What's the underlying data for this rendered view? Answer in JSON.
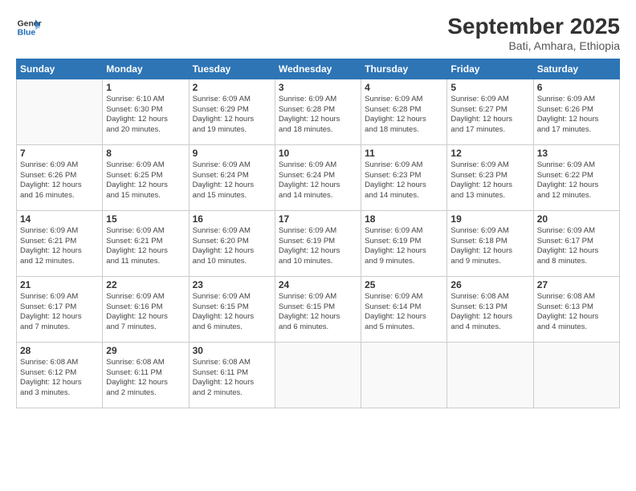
{
  "logo": {
    "line1": "General",
    "line2": "Blue"
  },
  "title": "September 2025",
  "location": "Bati, Amhara, Ethiopia",
  "days_header": [
    "Sunday",
    "Monday",
    "Tuesday",
    "Wednesday",
    "Thursday",
    "Friday",
    "Saturday"
  ],
  "weeks": [
    [
      {
        "day": "",
        "detail": ""
      },
      {
        "day": "1",
        "detail": "Sunrise: 6:10 AM\nSunset: 6:30 PM\nDaylight: 12 hours\nand 20 minutes."
      },
      {
        "day": "2",
        "detail": "Sunrise: 6:09 AM\nSunset: 6:29 PM\nDaylight: 12 hours\nand 19 minutes."
      },
      {
        "day": "3",
        "detail": "Sunrise: 6:09 AM\nSunset: 6:28 PM\nDaylight: 12 hours\nand 18 minutes."
      },
      {
        "day": "4",
        "detail": "Sunrise: 6:09 AM\nSunset: 6:28 PM\nDaylight: 12 hours\nand 18 minutes."
      },
      {
        "day": "5",
        "detail": "Sunrise: 6:09 AM\nSunset: 6:27 PM\nDaylight: 12 hours\nand 17 minutes."
      },
      {
        "day": "6",
        "detail": "Sunrise: 6:09 AM\nSunset: 6:26 PM\nDaylight: 12 hours\nand 17 minutes."
      }
    ],
    [
      {
        "day": "7",
        "detail": "Sunrise: 6:09 AM\nSunset: 6:26 PM\nDaylight: 12 hours\nand 16 minutes."
      },
      {
        "day": "8",
        "detail": "Sunrise: 6:09 AM\nSunset: 6:25 PM\nDaylight: 12 hours\nand 15 minutes."
      },
      {
        "day": "9",
        "detail": "Sunrise: 6:09 AM\nSunset: 6:24 PM\nDaylight: 12 hours\nand 15 minutes."
      },
      {
        "day": "10",
        "detail": "Sunrise: 6:09 AM\nSunset: 6:24 PM\nDaylight: 12 hours\nand 14 minutes."
      },
      {
        "day": "11",
        "detail": "Sunrise: 6:09 AM\nSunset: 6:23 PM\nDaylight: 12 hours\nand 14 minutes."
      },
      {
        "day": "12",
        "detail": "Sunrise: 6:09 AM\nSunset: 6:23 PM\nDaylight: 12 hours\nand 13 minutes."
      },
      {
        "day": "13",
        "detail": "Sunrise: 6:09 AM\nSunset: 6:22 PM\nDaylight: 12 hours\nand 12 minutes."
      }
    ],
    [
      {
        "day": "14",
        "detail": "Sunrise: 6:09 AM\nSunset: 6:21 PM\nDaylight: 12 hours\nand 12 minutes."
      },
      {
        "day": "15",
        "detail": "Sunrise: 6:09 AM\nSunset: 6:21 PM\nDaylight: 12 hours\nand 11 minutes."
      },
      {
        "day": "16",
        "detail": "Sunrise: 6:09 AM\nSunset: 6:20 PM\nDaylight: 12 hours\nand 10 minutes."
      },
      {
        "day": "17",
        "detail": "Sunrise: 6:09 AM\nSunset: 6:19 PM\nDaylight: 12 hours\nand 10 minutes."
      },
      {
        "day": "18",
        "detail": "Sunrise: 6:09 AM\nSunset: 6:19 PM\nDaylight: 12 hours\nand 9 minutes."
      },
      {
        "day": "19",
        "detail": "Sunrise: 6:09 AM\nSunset: 6:18 PM\nDaylight: 12 hours\nand 9 minutes."
      },
      {
        "day": "20",
        "detail": "Sunrise: 6:09 AM\nSunset: 6:17 PM\nDaylight: 12 hours\nand 8 minutes."
      }
    ],
    [
      {
        "day": "21",
        "detail": "Sunrise: 6:09 AM\nSunset: 6:17 PM\nDaylight: 12 hours\nand 7 minutes."
      },
      {
        "day": "22",
        "detail": "Sunrise: 6:09 AM\nSunset: 6:16 PM\nDaylight: 12 hours\nand 7 minutes."
      },
      {
        "day": "23",
        "detail": "Sunrise: 6:09 AM\nSunset: 6:15 PM\nDaylight: 12 hours\nand 6 minutes."
      },
      {
        "day": "24",
        "detail": "Sunrise: 6:09 AM\nSunset: 6:15 PM\nDaylight: 12 hours\nand 6 minutes."
      },
      {
        "day": "25",
        "detail": "Sunrise: 6:09 AM\nSunset: 6:14 PM\nDaylight: 12 hours\nand 5 minutes."
      },
      {
        "day": "26",
        "detail": "Sunrise: 6:08 AM\nSunset: 6:13 PM\nDaylight: 12 hours\nand 4 minutes."
      },
      {
        "day": "27",
        "detail": "Sunrise: 6:08 AM\nSunset: 6:13 PM\nDaylight: 12 hours\nand 4 minutes."
      }
    ],
    [
      {
        "day": "28",
        "detail": "Sunrise: 6:08 AM\nSunset: 6:12 PM\nDaylight: 12 hours\nand 3 minutes."
      },
      {
        "day": "29",
        "detail": "Sunrise: 6:08 AM\nSunset: 6:11 PM\nDaylight: 12 hours\nand 2 minutes."
      },
      {
        "day": "30",
        "detail": "Sunrise: 6:08 AM\nSunset: 6:11 PM\nDaylight: 12 hours\nand 2 minutes."
      },
      {
        "day": "",
        "detail": ""
      },
      {
        "day": "",
        "detail": ""
      },
      {
        "day": "",
        "detail": ""
      },
      {
        "day": "",
        "detail": ""
      }
    ]
  ]
}
